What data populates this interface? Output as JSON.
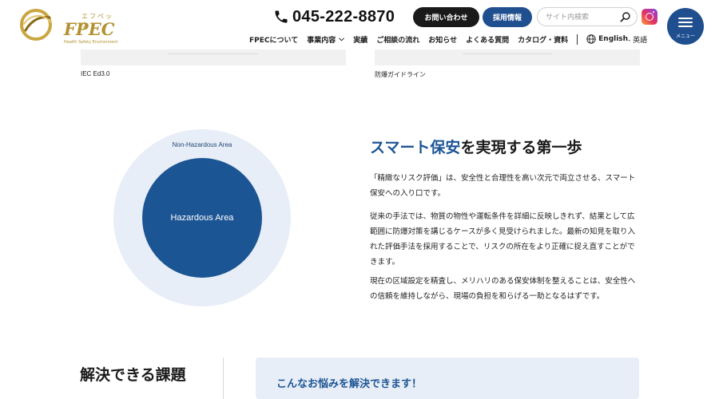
{
  "header": {
    "logo_kana": "エフペック",
    "logo_main": "FPEC",
    "logo_sub": "Health Safety Environment",
    "phone": "045-222-8870",
    "contact_button": "お問い合わせ",
    "recruit_button": "採用情報",
    "search_placeholder": "サイト内検索",
    "menu_label": "メニュー",
    "nav": {
      "items": [
        "FPECについて",
        "事業内容",
        "実績",
        "ご相談の流れ",
        "お知らせ",
        "よくある質問",
        "カタログ・資料"
      ],
      "lang_main": "English",
      "lang_sub": " - 英語"
    }
  },
  "cards": {
    "left_caption": "IEC Ed3.0",
    "right_caption": "防爆ガイドライン"
  },
  "diagram": {
    "outer_label": "Non-Hazardous Area",
    "inner_label": "Hazardous Area",
    "colors": {
      "outer": "#e8eef7",
      "inner": "#1c5594"
    }
  },
  "section": {
    "heading_accent": "スマート保安",
    "heading_rest": "を実現する第一歩",
    "paragraphs": [
      "「精緻なリスク評価」は、安全性と合理性を高い次元で両立させる、スマート保安への入り口です。",
      "従来の手法では、物質の物性や運転条件を詳細に反映しきれず、結果として広範囲に防爆対策を講じるケースが多く見受けられました。最新の知見を取り入れた評価手法を採用することで、リスクの所在をより正確に捉え直すことができます。",
      "現在の区域設定を精査し、メリハリのある保安体制を整えることは、安全性への信頼を維持しながら、現場の負担を和らげる一助となるはずです。"
    ]
  },
  "bottom": {
    "solve_title": "解決できる課題",
    "worry_text": "こんなお悩みを解決できます！"
  },
  "colors": {
    "brand_blue": "#1f4f8f",
    "gold": "#b3902f"
  }
}
